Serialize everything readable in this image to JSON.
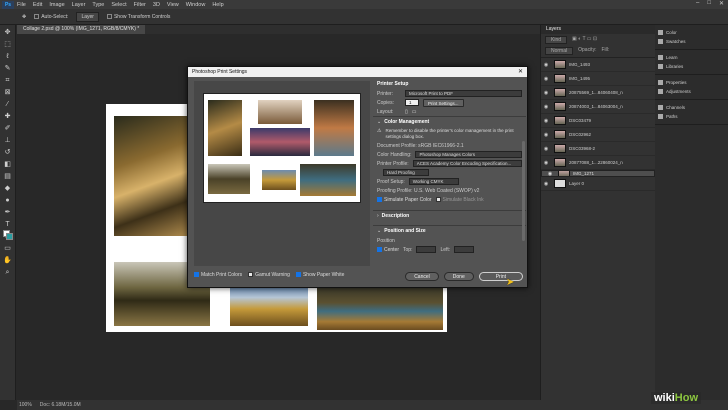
{
  "app": {
    "logo": "Ps"
  },
  "menu": [
    "File",
    "Edit",
    "Image",
    "Layer",
    "Type",
    "Select",
    "Filter",
    "3D",
    "View",
    "Window",
    "Help"
  ],
  "options_bar": {
    "auto_select": "Auto-Select:",
    "layer": "Layer",
    "transform": "Show Transform Controls"
  },
  "doc_tab": "Collage 2.psd @ 100% (IMG_1271, RGB/8/CMYK) *",
  "status": {
    "zoom": "100%",
    "doc": "Doc: 6.18M/15.0M"
  },
  "layers_panel": {
    "tab": "Layers",
    "kind": "Kind",
    "blend": "Normal",
    "opacity_label": "Opacity:",
    "fill_label": "Fill:",
    "layers": [
      {
        "name": "IMG_1493",
        "selected": false
      },
      {
        "name": "IMG_1495",
        "selected": false
      },
      {
        "name": "20875569_1...84060408_n",
        "selected": false
      },
      {
        "name": "20874003_1...84063004_n",
        "selected": false
      },
      {
        "name": "DSC03479",
        "selected": false
      },
      {
        "name": "DSC02962",
        "selected": false
      },
      {
        "name": "DSC03968-2",
        "selected": false
      },
      {
        "name": "20877088_1...22860024_n",
        "selected": false
      },
      {
        "name": "IMG_1271",
        "selected": true
      },
      {
        "name": "Layer 0",
        "selected": false
      }
    ]
  },
  "right_panels": [
    [
      "Color",
      "Swatches"
    ],
    [
      "Learn",
      "Libraries"
    ],
    [
      "Properties",
      "Adjustments"
    ],
    [
      "Channels",
      "Paths"
    ]
  ],
  "dialog": {
    "title": "Photoshop Print Settings",
    "close": "✕",
    "printer_setup": "Printer Setup",
    "printer_label": "Printer:",
    "printer_value": "Microsoft Print to PDF",
    "copies_label": "Copies:",
    "copies_value": "1",
    "print_settings_btn": "Print Settings...",
    "layout_label": "Layout:",
    "color_management": "Color Management",
    "cm_note": "Remember to disable the printer's color management in the print settings dialog box.",
    "doc_profile": "Document Profile: sRGB IEC61966-2.1",
    "color_handling_label": "Color Handling:",
    "color_handling_value": "Photoshop Manages Colors",
    "printer_profile_label": "Printer Profile:",
    "printer_profile_value": "ACES Academy Color Encoding Specification...",
    "proof_mode": "Hard Proofing",
    "proof_setup_label": "Proof Setup:",
    "proof_setup_value": "Working CMYK",
    "proofing_profile": "Proofing Profile: U.S. Web Coated (SWOP) v2",
    "simulate_paper": "Simulate Paper Color",
    "simulate_black": "Simulate Black Ink",
    "description": "Description",
    "position_size": "Position and Size",
    "position": "Position",
    "center": "Center",
    "top": "Top:",
    "left": "Left:",
    "match_colors": "Match Print Colors",
    "gamut_warning": "Gamut Warning",
    "show_paper_white": "Show Paper White",
    "cancel": "Cancel",
    "done": "Done",
    "print": "Print"
  },
  "watermark": {
    "wiki": "wiki",
    "how": "How"
  }
}
